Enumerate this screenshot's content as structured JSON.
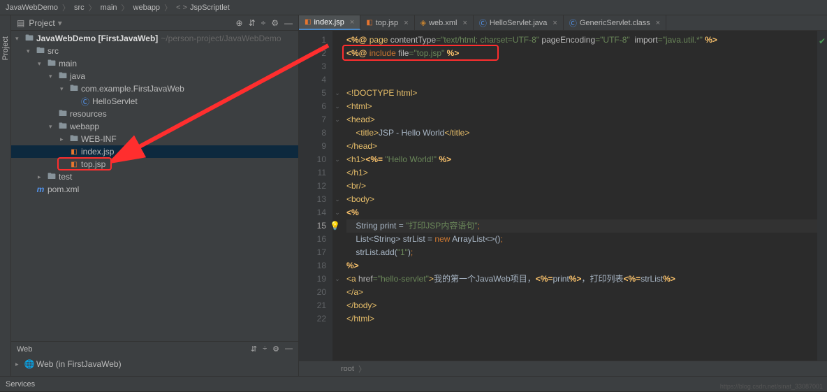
{
  "breadcrumb": [
    "JavaWebDemo",
    "src",
    "main",
    "webapp",
    "JspScriptlet"
  ],
  "sidebar": {
    "title": "Project",
    "tree": [
      {
        "indent": 0,
        "arrow": "▾",
        "icon": "folder",
        "label": "JavaWebDemo [FirstJavaWeb]",
        "hint": "~/person-project/JavaWebDemo",
        "bold": true
      },
      {
        "indent": 1,
        "arrow": "▾",
        "icon": "folder",
        "label": "src"
      },
      {
        "indent": 2,
        "arrow": "▾",
        "icon": "folder",
        "label": "main"
      },
      {
        "indent": 3,
        "arrow": "▾",
        "icon": "folder",
        "label": "java",
        "blue": true
      },
      {
        "indent": 4,
        "arrow": "▾",
        "icon": "folder",
        "label": "com.example.FirstJavaWeb"
      },
      {
        "indent": 5,
        "arrow": "",
        "icon": "class",
        "label": "HelloServlet"
      },
      {
        "indent": 3,
        "arrow": "",
        "icon": "folder",
        "label": "resources"
      },
      {
        "indent": 3,
        "arrow": "▾",
        "icon": "folder",
        "label": "webapp"
      },
      {
        "indent": 4,
        "arrow": "▸",
        "icon": "folder",
        "label": "WEB-INF"
      },
      {
        "indent": 4,
        "arrow": "",
        "icon": "jsp",
        "label": "index.jsp",
        "selected": true
      },
      {
        "indent": 4,
        "arrow": "",
        "icon": "jsp",
        "label": "top.jsp",
        "redbox": true
      },
      {
        "indent": 2,
        "arrow": "▸",
        "icon": "folder",
        "label": "test"
      },
      {
        "indent": 1,
        "arrow": "",
        "icon": "maven",
        "label": "pom.xml"
      }
    ],
    "web_panel_title": "Web",
    "web_item": "Web (in FirstJavaWeb)"
  },
  "tabs": [
    {
      "icon": "jsp",
      "label": "index.jsp",
      "active": true
    },
    {
      "icon": "jsp",
      "label": "top.jsp"
    },
    {
      "icon": "xml",
      "label": "web.xml"
    },
    {
      "icon": "class",
      "label": "HelloServlet.java"
    },
    {
      "icon": "class",
      "label": "GenericServlet.class"
    }
  ],
  "code_lines": [
    {
      "n": 1,
      "html": "<span class='k-yellow'>&lt;%@ </span><span class='k-tag'>page</span> <span class='k-attr'>contentType</span><span class='k-green'>=\"text/html; charset=UTF-8\"</span> <span class='k-attr'>pageEncoding</span><span class='k-green'>=\"UTF-8\"</span>  <span class='k-attr'>import</span><span class='k-green'>=\"java.util.*\"</span> <span class='k-yellow'>%&gt;</span>"
    },
    {
      "n": 2,
      "html": "<span class='k-yellow'>&lt;%@ </span><span class='k-orange'>include</span> <span class='k-attr'>file</span><span class='k-green'>=\"top.jsp\"</span> <span class='k-yellow'>%&gt;</span>",
      "redbox": true
    },
    {
      "n": 3,
      "html": ""
    },
    {
      "n": 4,
      "html": ""
    },
    {
      "n": 5,
      "html": "<span class='k-tag'>&lt;!DOCTYPE html&gt;</span>"
    },
    {
      "n": 6,
      "html": "<span class='k-tag'>&lt;html&gt;</span>"
    },
    {
      "n": 7,
      "html": "<span class='k-tag'>&lt;head&gt;</span>"
    },
    {
      "n": 8,
      "html": "    <span class='k-tag'>&lt;title&gt;</span><span class='k-white'>JSP - Hello World</span><span class='k-tag'>&lt;/title&gt;</span>"
    },
    {
      "n": 9,
      "html": "<span class='k-tag'>&lt;/head&gt;</span>"
    },
    {
      "n": 10,
      "html": "<span class='k-tag'>&lt;h1&gt;</span><span class='k-yellow'>&lt;%=</span> <span class='k-green'>\"Hello World!\"</span> <span class='k-yellow'>%&gt;</span>"
    },
    {
      "n": 11,
      "html": "<span class='k-tag'>&lt;/h1&gt;</span>"
    },
    {
      "n": 12,
      "html": "<span class='k-tag'>&lt;br/&gt;</span>"
    },
    {
      "n": 13,
      "html": "<span class='k-tag'>&lt;body&gt;</span>"
    },
    {
      "n": 14,
      "html": "<span class='k-yellow'>&lt;%</span>"
    },
    {
      "n": 15,
      "html": "    <span class='k-white'>String print = </span><span class='k-green'>\"打印JSP内容语句\"</span><span class='k-orange'>;</span>",
      "cur": true,
      "bulb": true
    },
    {
      "n": 16,
      "html": "    <span class='k-white'>List&lt;String&gt; strList = </span><span class='k-orange'>new</span> <span class='k-white'>ArrayList&lt;&gt;()</span><span class='k-orange'>;</span>"
    },
    {
      "n": 17,
      "html": "    <span class='k-white'>strList.add(</span><span class='k-green'>\"1\"</span><span class='k-white'>)</span><span class='k-orange'>;</span>"
    },
    {
      "n": 18,
      "html": "<span class='k-yellow'>%&gt;</span>"
    },
    {
      "n": 19,
      "html": "<span class='k-tag'>&lt;a </span><span class='k-attr'>href</span><span class='k-green'>=\"hello-servlet\"</span><span class='k-tag'>&gt;</span><span class='k-white'>我的第一个JavaWeb项目，</span><span class='k-yellow'>&lt;%=</span><span class='k-white'>print</span><span class='k-yellow'>%&gt;</span><span class='k-white'>，打印列表</span><span class='k-yellow'>&lt;%=</span><span class='k-white'>strList</span><span class='k-yellow'>%&gt;</span>"
    },
    {
      "n": 20,
      "html": "<span class='k-tag'>&lt;/a&gt;</span>"
    },
    {
      "n": 21,
      "html": "<span class='k-tag'>&lt;/body&gt;</span>"
    },
    {
      "n": 22,
      "html": "<span class='k-tag'>&lt;/html&gt;</span>"
    }
  ],
  "crumb": "root",
  "services_label": "Services",
  "left_strip": "Project",
  "watermark": "https://blog.csdn.net/sinat_33087001"
}
